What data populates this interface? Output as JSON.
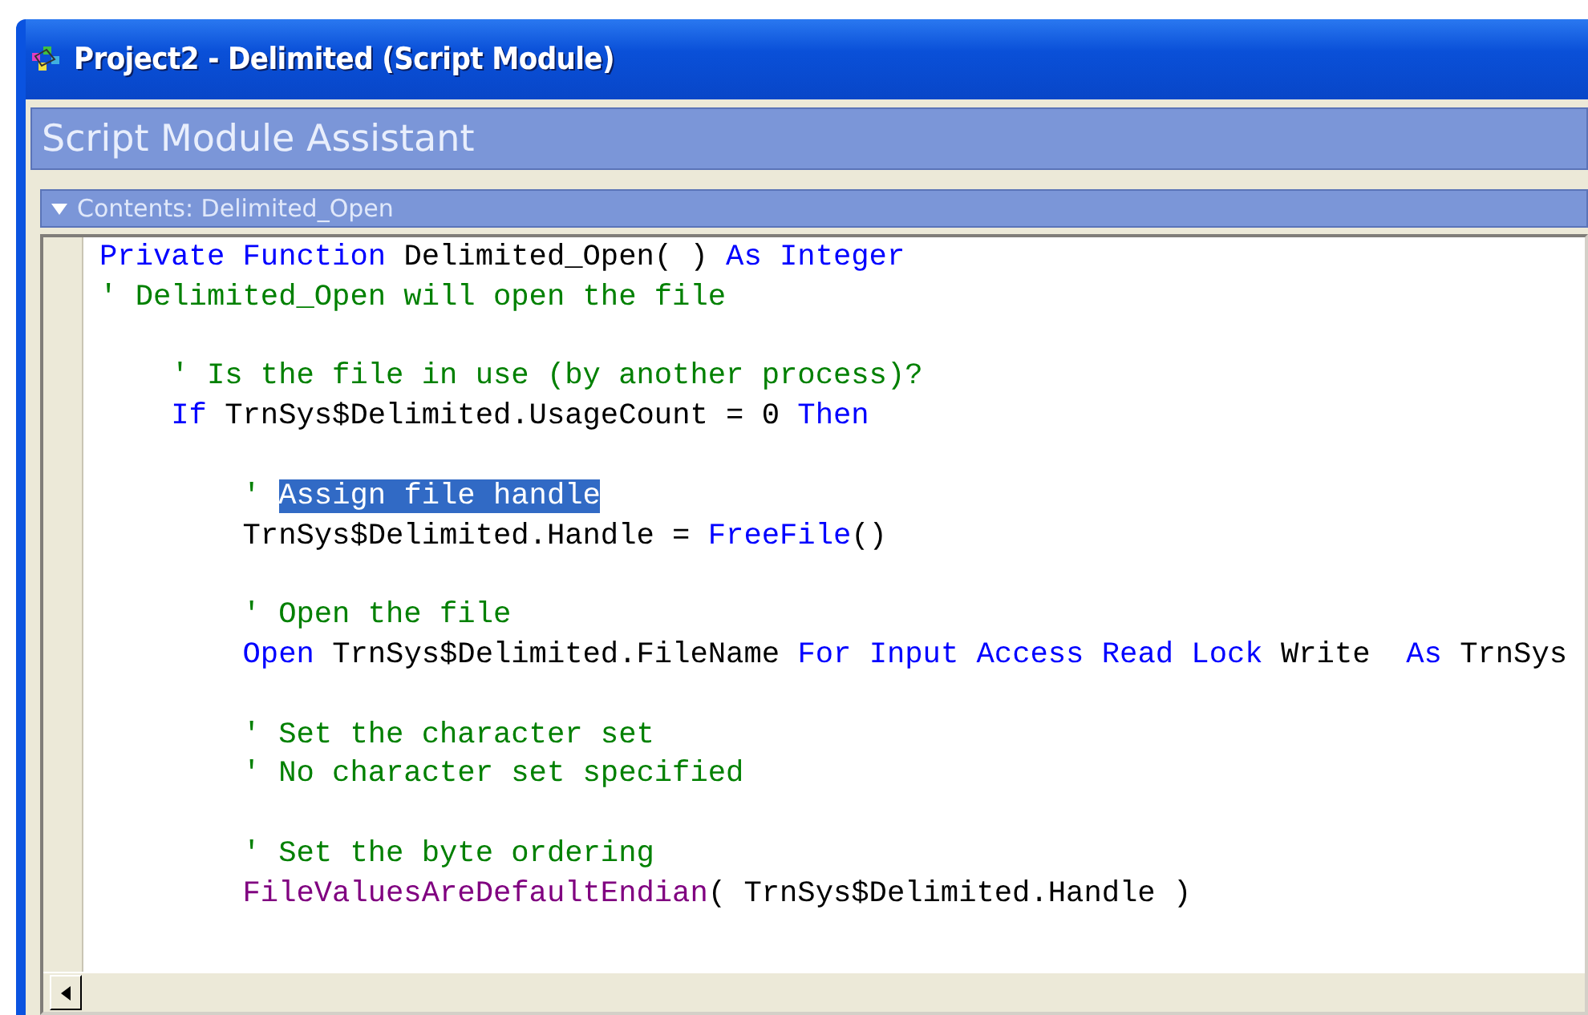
{
  "window": {
    "title": "Project2 - Delimited (Script Module)"
  },
  "assistant": {
    "title": "Script Module Assistant"
  },
  "contents": {
    "header": "Contents: Delimited_Open",
    "expanded": true
  },
  "editor": {
    "lines": [
      {
        "kind": "code",
        "tokens": [
          {
            "kind": "keyword",
            "text": "Private Function"
          },
          {
            "kind": "plain",
            "text": " Delimited_Open( ) "
          },
          {
            "kind": "keyword",
            "text": "As Integer"
          }
        ]
      },
      {
        "kind": "code",
        "tokens": [
          {
            "kind": "comment",
            "text": "' Delimited_Open will open the file"
          }
        ]
      },
      {
        "kind": "blank"
      },
      {
        "kind": "code",
        "tokens": [
          {
            "kind": "comment",
            "text": "    ' Is the file in use (by another process)?"
          }
        ]
      },
      {
        "kind": "code",
        "tokens": [
          {
            "kind": "keyword",
            "text": "    If"
          },
          {
            "kind": "plain",
            "text": " TrnSys$Delimited.UsageCount = 0 "
          },
          {
            "kind": "keyword",
            "text": "Then"
          }
        ]
      },
      {
        "kind": "blank"
      },
      {
        "kind": "code",
        "tokens": [
          {
            "kind": "comment",
            "text": "        ' "
          },
          {
            "kind": "selection",
            "text": "Assign file handle"
          }
        ]
      },
      {
        "kind": "code",
        "tokens": [
          {
            "kind": "plain",
            "text": "        TrnSys$Delimited.Handle = "
          },
          {
            "kind": "keyword",
            "text": "FreeFile"
          },
          {
            "kind": "plain",
            "text": "()"
          }
        ]
      },
      {
        "kind": "blank"
      },
      {
        "kind": "code",
        "tokens": [
          {
            "kind": "comment",
            "text": "        ' Open the file"
          }
        ]
      },
      {
        "kind": "code",
        "tokens": [
          {
            "kind": "keyword",
            "text": "        Open"
          },
          {
            "kind": "plain",
            "text": " TrnSys$Delimited.FileName "
          },
          {
            "kind": "keyword",
            "text": "For Input Access Read Lock"
          },
          {
            "kind": "plain",
            "text": " Write  "
          },
          {
            "kind": "keyword",
            "text": "As"
          },
          {
            "kind": "plain",
            "text": " TrnSys"
          }
        ]
      },
      {
        "kind": "blank"
      },
      {
        "kind": "code",
        "tokens": [
          {
            "kind": "comment",
            "text": "        ' Set the character set"
          }
        ]
      },
      {
        "kind": "code",
        "tokens": [
          {
            "kind": "comment",
            "text": "        ' No character set specified"
          }
        ]
      },
      {
        "kind": "blank"
      },
      {
        "kind": "code",
        "tokens": [
          {
            "kind": "comment",
            "text": "        ' Set the byte ordering"
          }
        ]
      },
      {
        "kind": "code",
        "tokens": [
          {
            "kind": "function",
            "text": "        FileValuesAreDefaultEndian"
          },
          {
            "kind": "plain",
            "text": "( TrnSys$Delimited.Handle )"
          }
        ]
      }
    ]
  }
}
